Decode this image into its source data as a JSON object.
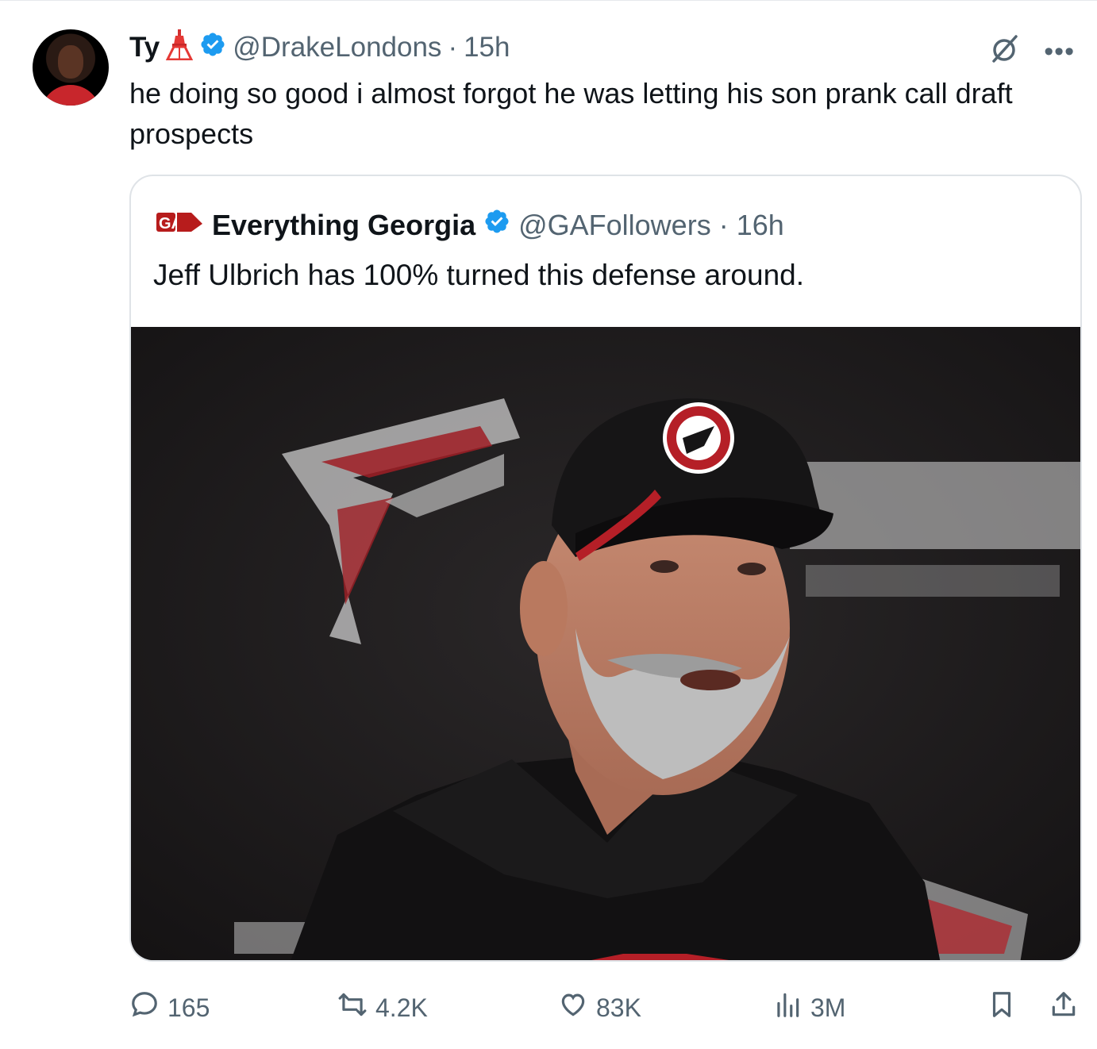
{
  "tweet": {
    "author_name": "Ty",
    "author_emoji": "tower-emoji",
    "handle": "@DrakeLondons",
    "separator": "·",
    "time": "15h",
    "text": "he doing so good i almost forgot he was letting his son prank call draft prospects"
  },
  "quote": {
    "logo_text": "GA",
    "author_name": "Everything Georgia",
    "handle": "@GAFollowers",
    "separator": "·",
    "time": "16h",
    "text": "Jeff Ulbrich has 100% turned this defense around."
  },
  "actions": {
    "replies": "165",
    "reposts": "4.2K",
    "likes": "83K",
    "views": "3M"
  },
  "colors": {
    "verified": "#1d9bf0",
    "muted": "#536471",
    "border": "#dfe3e7",
    "brand_red": "#b71c1c"
  },
  "icons": [
    "tower-icon",
    "verified-icon",
    "grok-icon",
    "more-icon",
    "reply-icon",
    "repost-icon",
    "like-icon",
    "views-icon",
    "bookmark-icon",
    "share-icon"
  ]
}
